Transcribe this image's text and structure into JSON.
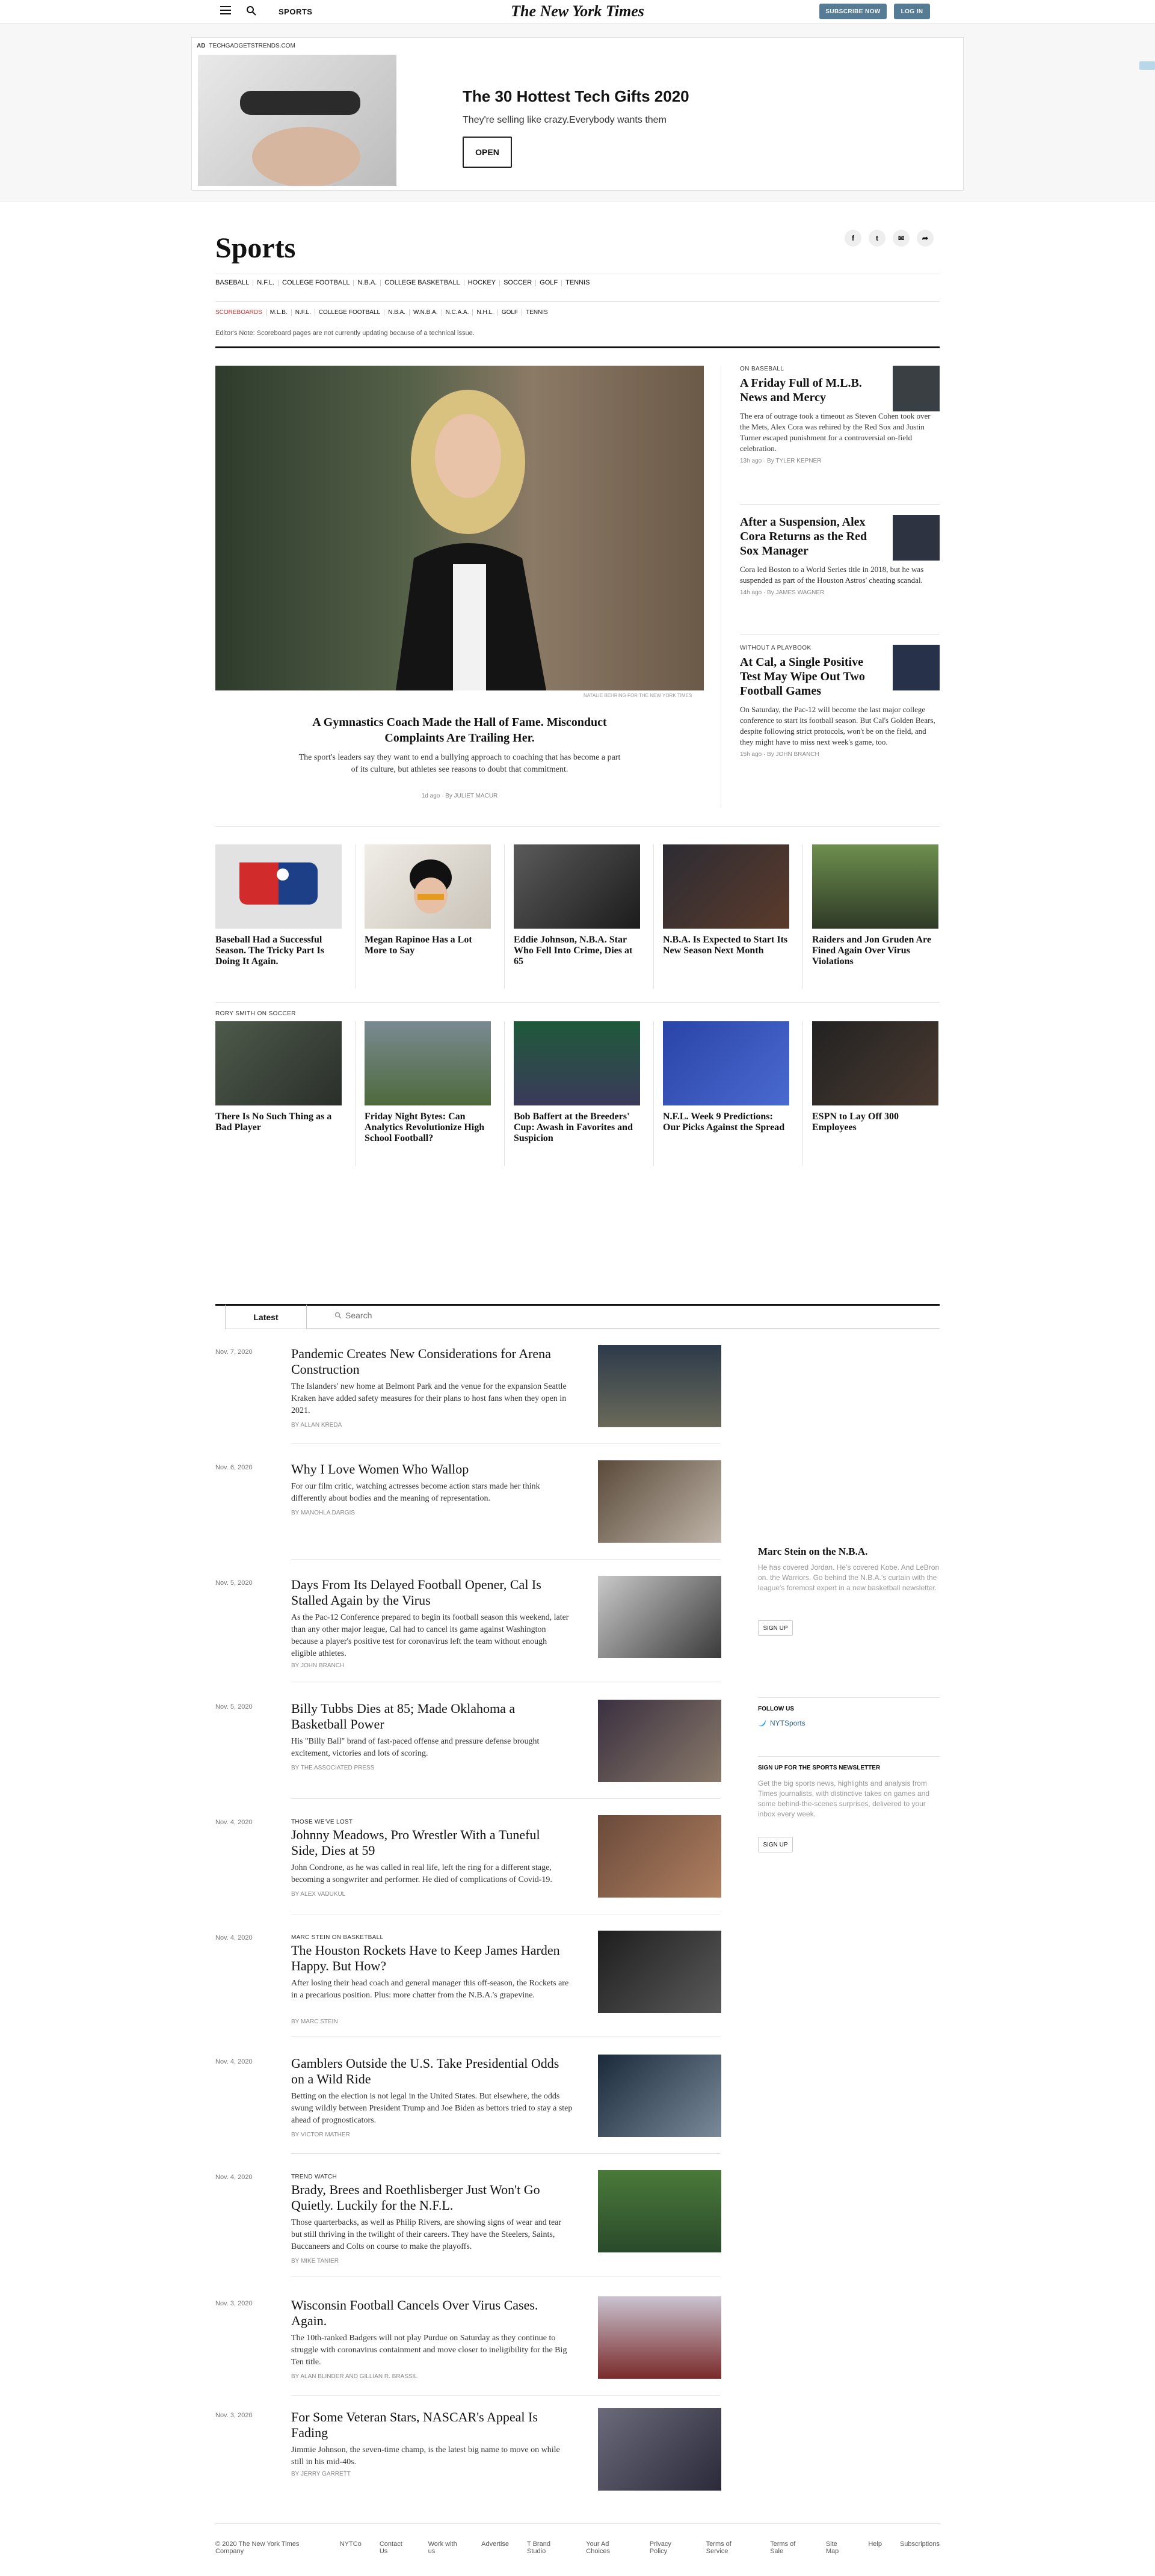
{
  "topbar": {
    "section": "SPORTS",
    "logo": "The New York Times",
    "subscribe": "SUBSCRIBE NOW",
    "login": "LOG IN"
  },
  "ad": {
    "label": "AD",
    "domain": "TECHGADGETSTRENDS.COM",
    "title": "The 30 Hottest Tech Gifts 2020",
    "description": "They're selling like crazy.Everybody wants them",
    "button": "OPEN"
  },
  "section": {
    "title": "Sports",
    "nav": [
      "BASEBALL",
      "N.F.L.",
      "COLLEGE FOOTBALL",
      "N.B.A.",
      "COLLEGE BASKETBALL",
      "HOCKEY",
      "SOCCER",
      "GOLF",
      "TENNIS"
    ],
    "scoreboards": [
      "SCOREBOARDS",
      "M.L.B.",
      "N.F.L.",
      "COLLEGE FOOTBALL",
      "N.B.A.",
      "W.N.B.A.",
      "N.C.A.A.",
      "N.H.L.",
      "GOLF",
      "TENNIS"
    ],
    "note": "Editor's Note: Scoreboard pages are not currently updating because of a technical issue."
  },
  "lead": {
    "credit": "NATALIE BEHRING FOR THE NEW YORK TIMES",
    "headline": "A Gymnastics Coach Made the Hall of Fame. Misconduct Complaints Are Trailing Her.",
    "summary": "The sport's leaders say they want to end a bullying approach to coaching that has become a part of its culture, but athletes see reasons to doubt that commitment.",
    "meta": "1d ago · By JULIET MACUR"
  },
  "rightcol": [
    {
      "kicker": "ON BASEBALL",
      "headline": "A Friday Full of M.L.B. News and Mercy",
      "summary": "The era of outrage took a timeout as Steven Cohen took over the Mets, Alex Cora was rehired by the Red Sox and Justin Turner escaped punishment for a controversial on-field celebration.",
      "meta": "13h ago · By TYLER KEPNER"
    },
    {
      "kicker": "",
      "headline": "After a Suspension, Alex Cora Returns as the Red Sox Manager",
      "summary": "Cora led Boston to a World Series title in 2018, but he was suspended as part of the Houston Astros' cheating scandal.",
      "meta": "14h ago · By JAMES WAGNER"
    },
    {
      "kicker": "WITHOUT A PLAYBOOK",
      "headline": "At Cal, a Single Positive Test May Wipe Out Two Football Games",
      "summary": "On Saturday, the Pac-12 will become the last major college conference to start its football season. But Cal's Golden Bears, despite following strict protocols, won't be on the field, and they might have to miss next week's game, too.",
      "meta": "15h ago · By JOHN BRANCH"
    }
  ],
  "row1": [
    {
      "headline": "Baseball Had a Successful Season. The Tricky Part Is Doing It Again."
    },
    {
      "headline": "Megan Rapinoe Has a Lot More to Say"
    },
    {
      "headline": "Eddie Johnson, N.B.A. Star Who Fell Into Crime, Dies at 65"
    },
    {
      "headline": "N.B.A. Is Expected to Start Its New Season Next Month"
    },
    {
      "headline": "Raiders and Jon Gruden Are Fined Again Over Virus Violations"
    }
  ],
  "row2_kicker": "RORY SMITH ON SOCCER",
  "row2": [
    {
      "headline": "There Is No Such Thing as a Bad Player"
    },
    {
      "headline": "Friday Night Bytes: Can Analytics Revolutionize High School Football?"
    },
    {
      "headline": "Bob Baffert at the Breeders' Cup: Awash in Favorites and Suspicion"
    },
    {
      "headline": "N.F.L. Week 9 Predictions: Our Picks Against the Spread"
    },
    {
      "headline": "ESPN to Lay Off 300 Employees"
    }
  ],
  "latest": {
    "tab": "Latest",
    "search": "Search",
    "stories": [
      {
        "date": "Nov. 7, 2020",
        "kicker": "",
        "headline": "Pandemic Creates New Considerations for Arena Construction",
        "summary": "The Islanders' new home at Belmont Park and the venue for the expansion Seattle Kraken have added safety measures for their plans to host fans when they open in 2021.",
        "byline": "By ALLAN KREDA"
      },
      {
        "date": "Nov. 6, 2020",
        "kicker": "",
        "headline": "Why I Love Women Who Wallop",
        "summary": "For our film critic, watching actresses become action stars made her think differently about bodies and the meaning of representation.",
        "byline": "By MANOHLA DARGIS"
      },
      {
        "date": "Nov. 5, 2020",
        "kicker": "",
        "headline": "Days From Its Delayed Football Opener, Cal Is Stalled Again by the Virus",
        "summary": "As the Pac-12 Conference prepared to begin its football season this weekend, later than any other major league, Cal had to cancel its game against Washington because a player's positive test for coronavirus left the team without enough eligible athletes.",
        "byline": "By JOHN BRANCH"
      },
      {
        "date": "Nov. 5, 2020",
        "kicker": "",
        "headline": "Billy Tubbs Dies at 85; Made Oklahoma a Basketball Power",
        "summary": "His \"Billy Ball\" brand of fast-paced offense and pressure defense brought excitement, victories and lots of scoring.",
        "byline": "By THE ASSOCIATED PRESS"
      },
      {
        "date": "Nov. 4, 2020",
        "kicker": "THOSE WE'VE LOST",
        "headline": "Johnny Meadows, Pro Wrestler With a Tuneful Side, Dies at 59",
        "summary": "John Condrone, as he was called in real life, left the ring for a different stage, becoming a songwriter and performer. He died of complications of Covid-19.",
        "byline": "By ALEX VADUKUL"
      },
      {
        "date": "Nov. 4, 2020",
        "kicker": "MARC STEIN ON BASKETBALL",
        "headline": "The Houston Rockets Have to Keep James Harden Happy. But How?",
        "summary": "After losing their head coach and general manager this off-season, the Rockets are in a precarious position. Plus: more chatter from the N.B.A.'s grapevine.",
        "byline": "By MARC STEIN"
      },
      {
        "date": "Nov. 4, 2020",
        "kicker": "",
        "headline": "Gamblers Outside the U.S. Take Presidential Odds on a Wild Ride",
        "summary": "Betting on the election is not legal in the United States. But elsewhere, the odds swung wildly between President Trump and Joe Biden as bettors tried to stay a step ahead of prognosticators.",
        "byline": "By VICTOR MATHER"
      },
      {
        "date": "Nov. 4, 2020",
        "kicker": "TREND WATCH",
        "headline": "Brady, Brees and Roethlisberger Just Won't Go Quietly. Luckily for the N.F.L.",
        "summary": "Those quarterbacks, as well as Philip Rivers, are showing signs of wear and tear but still thriving in the twilight of their careers. They have the Steelers, Saints, Buccaneers and Colts on course to make the playoffs.",
        "byline": "By MIKE TANIER"
      },
      {
        "date": "Nov. 3, 2020",
        "kicker": "",
        "headline": "Wisconsin Football Cancels Over Virus Cases. Again.",
        "summary": "The 10th-ranked Badgers will not play Purdue on Saturday as they continue to struggle with coronavirus containment and move closer to ineligibility for the Big Ten title.",
        "byline": "By ALAN BLINDER and GILLIAN R. BRASSIL"
      },
      {
        "date": "Nov. 3, 2020",
        "kicker": "",
        "headline": "For Some Veteran Stars, NASCAR's Appeal Is Fading",
        "summary": "Jimmie Johnson, the seven-time champ, is the latest big name to move on while still in his mid-40s.",
        "byline": "By JERRY GARRETT"
      }
    ]
  },
  "sidebar": {
    "newsletter1_title": "Marc Stein on the N.B.A.",
    "newsletter1_text": "He has covered Jordan. He's covered Kobe. And LeBron on. the Warriors. Go behind the N.B.A.'s curtain with the league's foremost expert in a new basketball newsletter.",
    "signup": "SIGN UP",
    "follow": "FOLLOW US",
    "twitter": "NYTSports",
    "newsletter2_title": "SIGN UP FOR THE SPORTS NEWSLETTER",
    "newsletter2_text": "Get the big sports news, highlights and analysis from Times journalists, with distinctive takes on games and some behind-the-scenes surprises, delivered to your inbox every week."
  },
  "footer": [
    "© 2020 The New York Times Company",
    "NYTCo",
    "Contact Us",
    "Work with us",
    "Advertise",
    "T Brand Studio",
    "Your Ad Choices",
    "Privacy Policy",
    "Terms of Service",
    "Terms of Sale",
    "Site Map",
    "Help",
    "Subscriptions"
  ],
  "colors": {
    "brand_blue": "#567b95",
    "scoreboard_red": "#c42b2b",
    "twitter_blue": "#1da1f2"
  }
}
